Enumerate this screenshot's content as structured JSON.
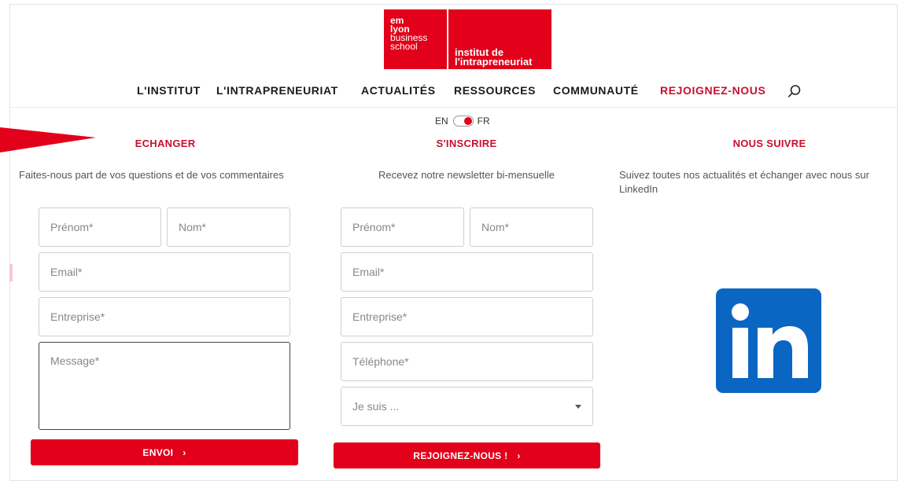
{
  "logo": {
    "left_lines": [
      "em",
      "lyon",
      "business",
      "school"
    ],
    "right_lines": [
      "institut de",
      "l'intrapreneuriat"
    ]
  },
  "nav": {
    "items": [
      {
        "label": "L'INSTITUT"
      },
      {
        "label": "L'INTRAPRENEURIAT"
      },
      {
        "label": "ACTUALITÉS"
      },
      {
        "label": "RESSOURCES"
      },
      {
        "label": "COMMUNAUTÉ"
      },
      {
        "label": "REJOIGNEZ-NOUS",
        "active": true
      }
    ],
    "search_icon": "search-icon"
  },
  "lang": {
    "left": "EN",
    "right": "FR",
    "selected": "FR"
  },
  "columns": {
    "echanger": {
      "title": "ECHANGER",
      "description": "Faites-nous part de vos questions et de vos commentaires",
      "fields": {
        "prenom": "Prénom*",
        "nom": "Nom*",
        "email": "Email*",
        "entreprise": "Entreprise*",
        "message": "Message*"
      },
      "button": "ENVOI",
      "button_chevron": "›"
    },
    "inscrire": {
      "title": "S'INSCRIRE",
      "description": "Recevez notre newsletter bi-mensuelle",
      "fields": {
        "prenom": "Prénom*",
        "nom": "Nom*",
        "email": "Email*",
        "entreprise": "Entreprise*",
        "telephone": "Téléphone*",
        "select": "Je suis ..."
      },
      "button": "REJOIGNEZ-NOUS !",
      "button_chevron": "›"
    },
    "suivre": {
      "title": "NOUS SUIVRE",
      "description": "Suivez toutes nos actualités et échanger avec nous sur LinkedIn",
      "icon": "linkedin-icon",
      "icon_text": "in"
    }
  },
  "colors": {
    "brand_red": "#e2001a",
    "title_red": "#c8102e",
    "linkedin_blue": "#0a66c2"
  }
}
